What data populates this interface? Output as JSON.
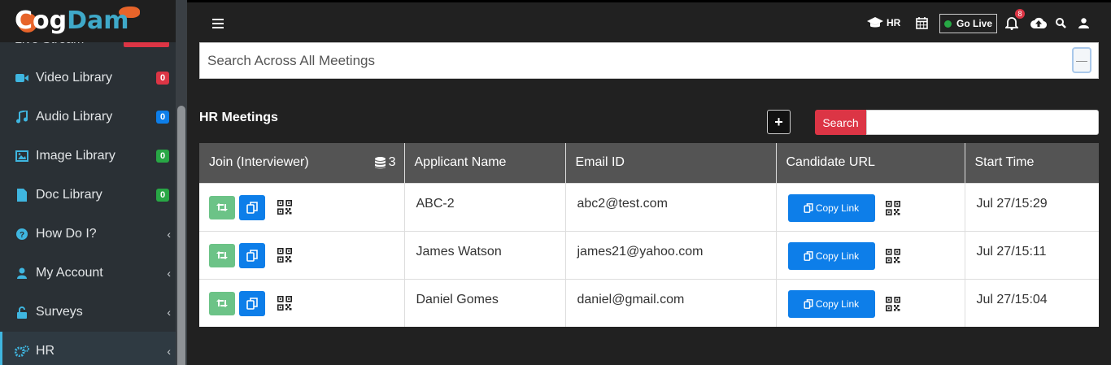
{
  "app": {
    "logo_part1": "Cog",
    "logo_part2": "Dam"
  },
  "sidebar": {
    "ghost_item": "Live Stream",
    "items": [
      {
        "label": "Video Library",
        "badge": "0",
        "badge_color": "#dc3545",
        "icon": "video-icon"
      },
      {
        "label": "Audio Library",
        "badge": "0",
        "badge_color": "#0d7ee9",
        "icon": "music-icon"
      },
      {
        "label": "Image Library",
        "badge": "0",
        "badge_color": "#28a745",
        "icon": "image-icon"
      },
      {
        "label": "Doc Library",
        "badge": "0",
        "badge_color": "#28a745",
        "icon": "file-icon"
      },
      {
        "label": "How Do I?",
        "icon": "question-icon"
      },
      {
        "label": "My Account",
        "icon": "user-icon"
      },
      {
        "label": "Surveys",
        "icon": "lock-icon"
      },
      {
        "label": "HR",
        "icon": "gears-icon",
        "active": true
      }
    ]
  },
  "header": {
    "hr_label": "HR",
    "go_live_label": "Go Live",
    "notification_count": "8"
  },
  "search_all": {
    "placeholder": "Search Across All Meetings",
    "value": ""
  },
  "section": {
    "title": "HR Meetings",
    "add_label": "+",
    "search_label": "Search",
    "search_value": ""
  },
  "table": {
    "columns": [
      "Join (Interviewer)",
      "Applicant Name",
      "Email ID",
      "Candidate URL",
      "Start Time"
    ],
    "count": "3",
    "copy_label": "Copy Link",
    "rows": [
      {
        "name": "ABC-2",
        "email": "abc2@test.com",
        "start": "Jul 27/15:29"
      },
      {
        "name": "James Watson",
        "email": "james21@yahoo.com",
        "start": "Jul 27/15:11"
      },
      {
        "name": "Daniel Gomes",
        "email": "daniel@gmail.com",
        "start": "Jul 27/15:04"
      }
    ]
  },
  "colors": {
    "accent_blue": "#0d7ee9",
    "danger_red": "#dc3545",
    "success_green": "#6cc387",
    "sidebar_bg": "#2a3035"
  }
}
